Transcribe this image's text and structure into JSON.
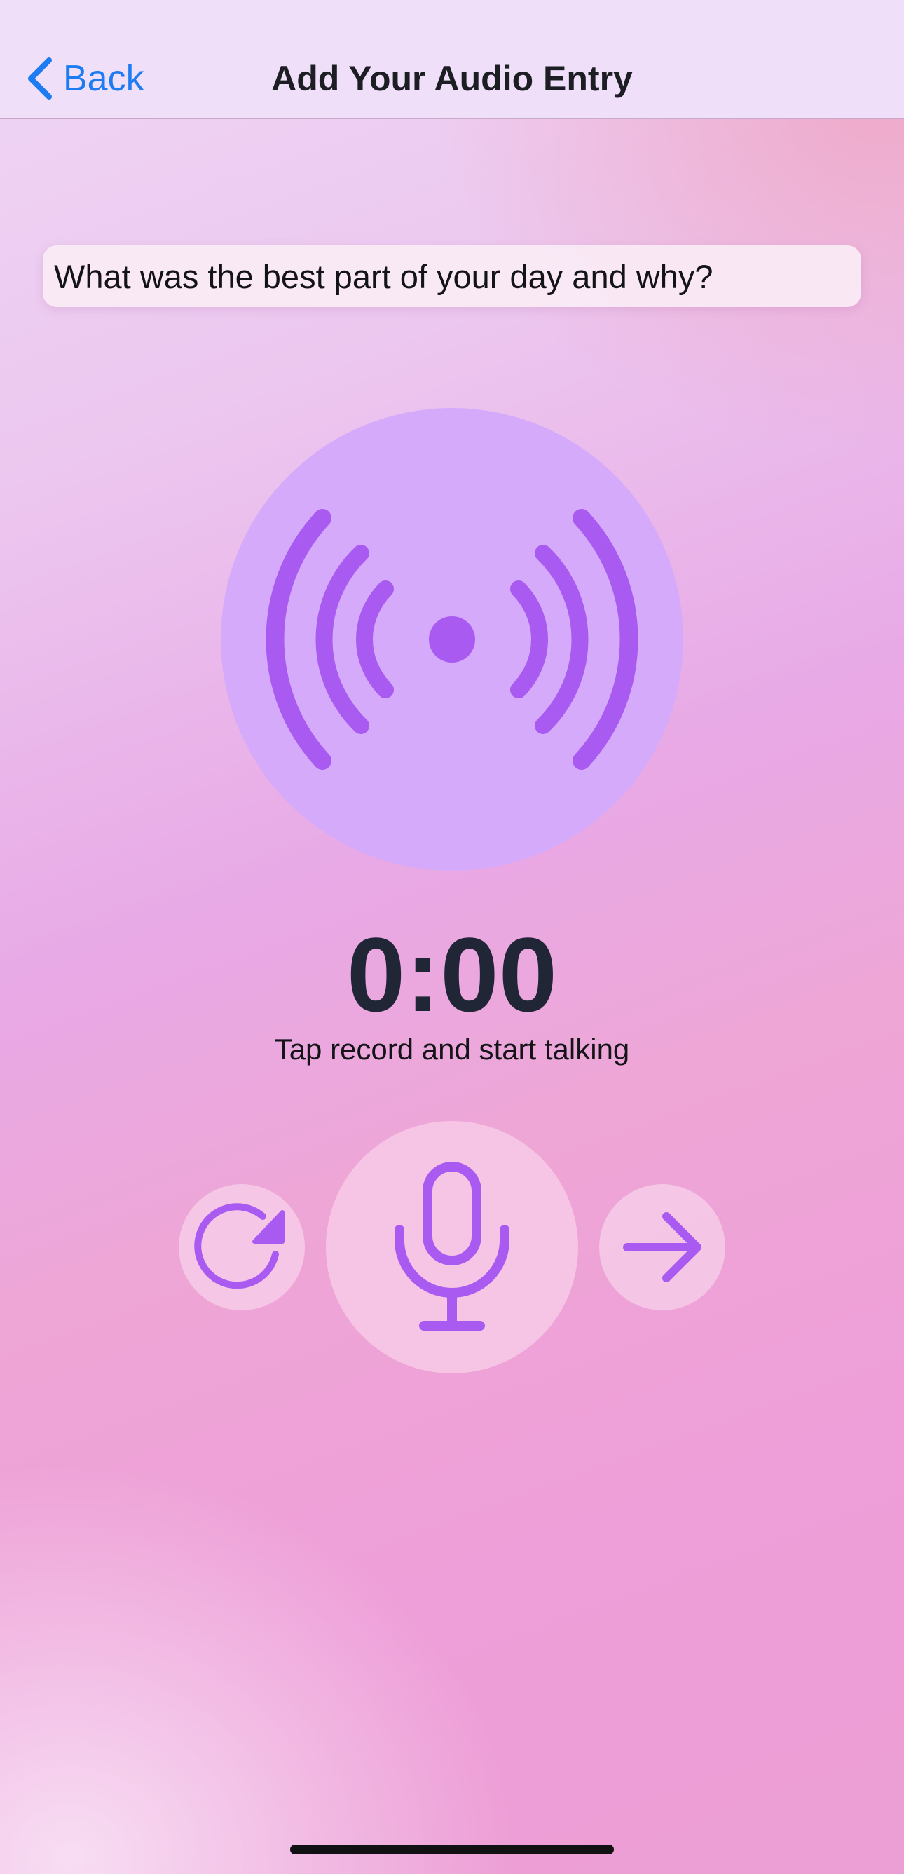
{
  "nav": {
    "back_label": "Back",
    "title": "Add Your Audio Entry"
  },
  "prompt": {
    "text": "What was the best part of your day and why?"
  },
  "recorder": {
    "timer": "0:00",
    "hint": "Tap record and start talking",
    "state_icon": "broadcast-icon",
    "controls": [
      {
        "name": "reset-button",
        "icon": "rotate-clockwise-icon"
      },
      {
        "name": "record-button",
        "icon": "microphone-icon"
      },
      {
        "name": "next-button",
        "icon": "arrow-right-icon"
      }
    ]
  },
  "colors": {
    "accent": "#a95af0",
    "link": "#1e7cf2",
    "timer_text": "#212637",
    "broadcast_bg": "#d5aafb"
  }
}
